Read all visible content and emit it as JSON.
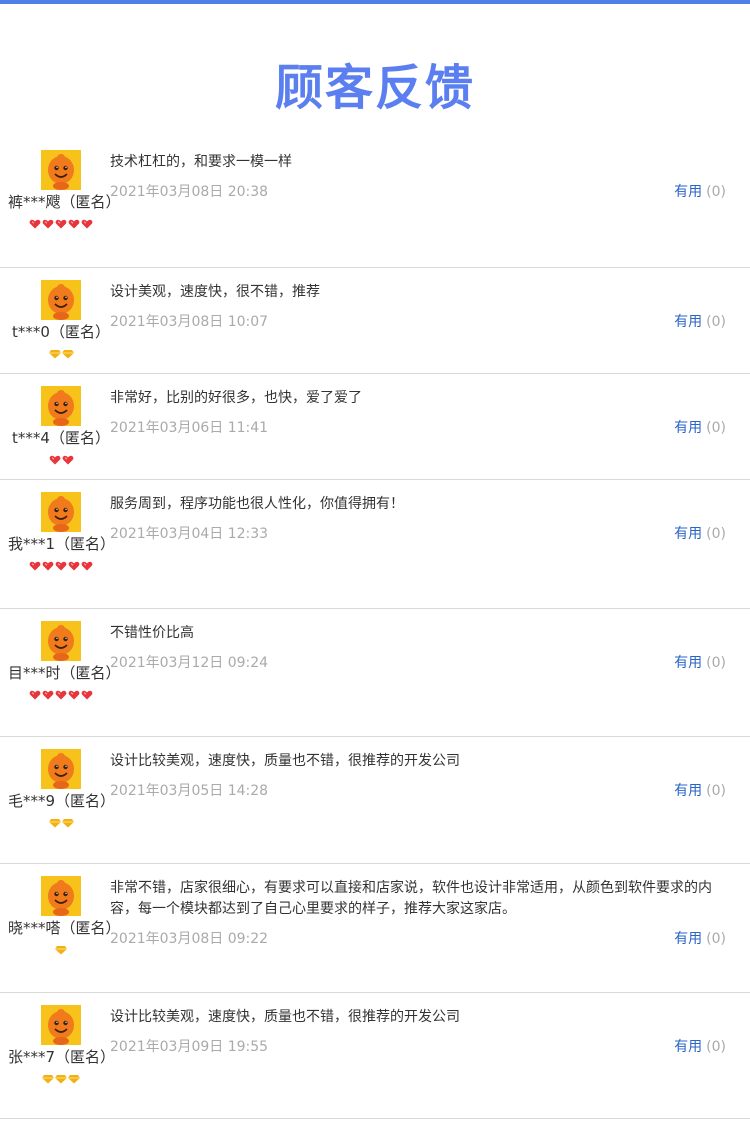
{
  "page": {
    "title": "顾客反馈"
  },
  "colors": {
    "accent": "#5b7ff0",
    "top_bar": "#4d7fe8",
    "useful_link": "#2b64c8",
    "date": "#aaaaaa",
    "divider": "#d9d9d9"
  },
  "reviews": [
    {
      "user": "裤***飕（匿名）",
      "badge_type": "red-heart",
      "badge_count": 5,
      "text": "技术杠杠的，和要求一模一样",
      "date": "2021年03月08日 20:38",
      "useful_label": "有用",
      "useful_count": "(0)"
    },
    {
      "user": "t***0（匿名）",
      "badge_type": "gold-diamond",
      "badge_count": 2,
      "text": "设计美观，速度快，很不错，推荐",
      "date": "2021年03月08日 10:07",
      "useful_label": "有用",
      "useful_count": "(0)"
    },
    {
      "user": "t***4（匿名）",
      "badge_type": "red-heart",
      "badge_count": 2,
      "text": "非常好，比别的好很多，也快，爱了爱了",
      "date": "2021年03月06日 11:41",
      "useful_label": "有用",
      "useful_count": "(0)"
    },
    {
      "user": "我***1（匿名）",
      "badge_type": "red-heart",
      "badge_count": 5,
      "text": "服务周到，程序功能也很人性化，你值得拥有！",
      "date": "2021年03月04日 12:33",
      "useful_label": "有用",
      "useful_count": "(0)"
    },
    {
      "user": "目***时（匿名）",
      "badge_type": "red-heart",
      "badge_count": 5,
      "text": "不错性价比高",
      "date": "2021年03月12日 09:24",
      "useful_label": "有用",
      "useful_count": "(0)"
    },
    {
      "user": "毛***9（匿名）",
      "badge_type": "gold-diamond",
      "badge_count": 2,
      "text": "设计比较美观，速度快，质量也不错，很推荐的开发公司",
      "date": "2021年03月05日 14:28",
      "useful_label": "有用",
      "useful_count": "(0)"
    },
    {
      "user": "晓***嗒（匿名）",
      "badge_type": "gold-diamond",
      "badge_count": 1,
      "text": "非常不错，店家很细心，有要求可以直接和店家说，软件也设计非常适用，从颜色到软件要求的内容，每一个模块都达到了自己心里要求的样子，推荐大家这家店。",
      "date": "2021年03月08日 09:22",
      "useful_label": "有用",
      "useful_count": "(0)"
    },
    {
      "user": "张***7（匿名）",
      "badge_type": "gold-diamond",
      "badge_count": 3,
      "text": "设计比较美观，速度快，质量也不错，很推荐的开发公司",
      "date": "2021年03月09日 19:55",
      "useful_label": "有用",
      "useful_count": "(0)"
    }
  ]
}
